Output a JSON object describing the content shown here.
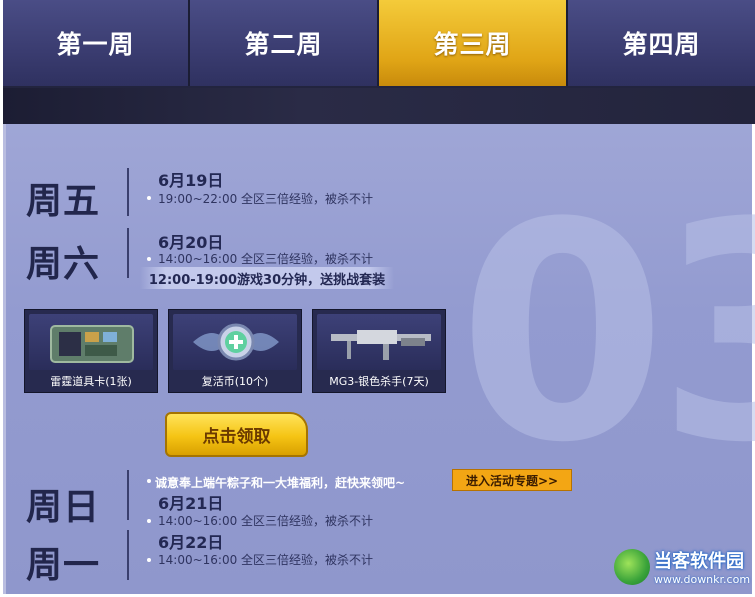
{
  "tabs": [
    {
      "label": "第一周",
      "active": false
    },
    {
      "label": "第二周",
      "active": false
    },
    {
      "label": "第三周",
      "active": true
    },
    {
      "label": "第四周",
      "active": false
    }
  ],
  "background_number": "03",
  "schedule": [
    {
      "day": "周五",
      "date": "6月19日",
      "desc": "19:00~22:00 全区三倍经验，被杀不计"
    },
    {
      "day": "周六",
      "date": "6月20日",
      "desc": "14:00~16:00 全区三倍经验，被杀不计",
      "banner": "12:00-19:00游戏30分钟，送挑战套装"
    },
    {
      "day": "周日",
      "date": "6月21日",
      "desc": "14:00~16:00 全区三倍经验，被杀不计"
    },
    {
      "day": "周一",
      "date": "6月22日",
      "desc": "14:00~16:00 全区三倍经验，被杀不计"
    }
  ],
  "rewards": [
    {
      "caption": "雷霆道具卡(1张)",
      "icon": "item-card-icon"
    },
    {
      "caption": "复活币(10个)",
      "icon": "revive-coin-icon"
    },
    {
      "caption": "MG3-银色杀手(7天)",
      "icon": "machine-gun-icon"
    }
  ],
  "claim_button": "点击领取",
  "promo_text": "诚意奉上端午粽子和一大堆福利，赶快来领吧~",
  "topic_button": "进入活动专题>>",
  "watermark": {
    "title": "当客软件园",
    "url": "www.downkr.com"
  },
  "colors": {
    "active_tab": "#e8b21f",
    "tab": "#3f4278",
    "panel": "#959dd2",
    "claim": "#f5c414",
    "topic": "#f3a614"
  }
}
